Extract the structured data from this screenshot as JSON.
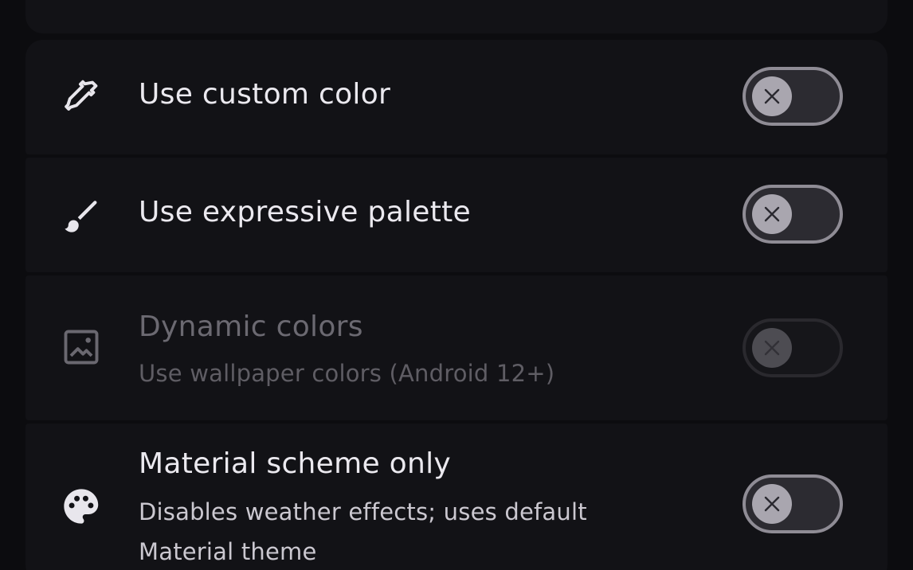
{
  "settings": [
    {
      "icon": "eyedropper-icon",
      "title": "Use custom color",
      "subtitle": "",
      "enabled": true,
      "checked": false
    },
    {
      "icon": "brush-icon",
      "title": "Use expressive palette",
      "subtitle": "",
      "enabled": true,
      "checked": false
    },
    {
      "icon": "wallpaper-icon",
      "title": "Dynamic colors",
      "subtitle": "Use wallpaper colors (Android 12+)",
      "enabled": false,
      "checked": false
    },
    {
      "icon": "palette-icon",
      "title": "Material scheme only",
      "subtitle": "Disables weather effects; uses default Material theme",
      "enabled": true,
      "checked": false
    }
  ],
  "colors": {
    "background": "#0c0c0f",
    "card": "#121216",
    "text": "#ebe9ef",
    "text_disabled": "#6b6971",
    "switch_track": "#2c2b31",
    "switch_outline": "#8f8c95",
    "switch_thumb": "#a9a6af"
  }
}
